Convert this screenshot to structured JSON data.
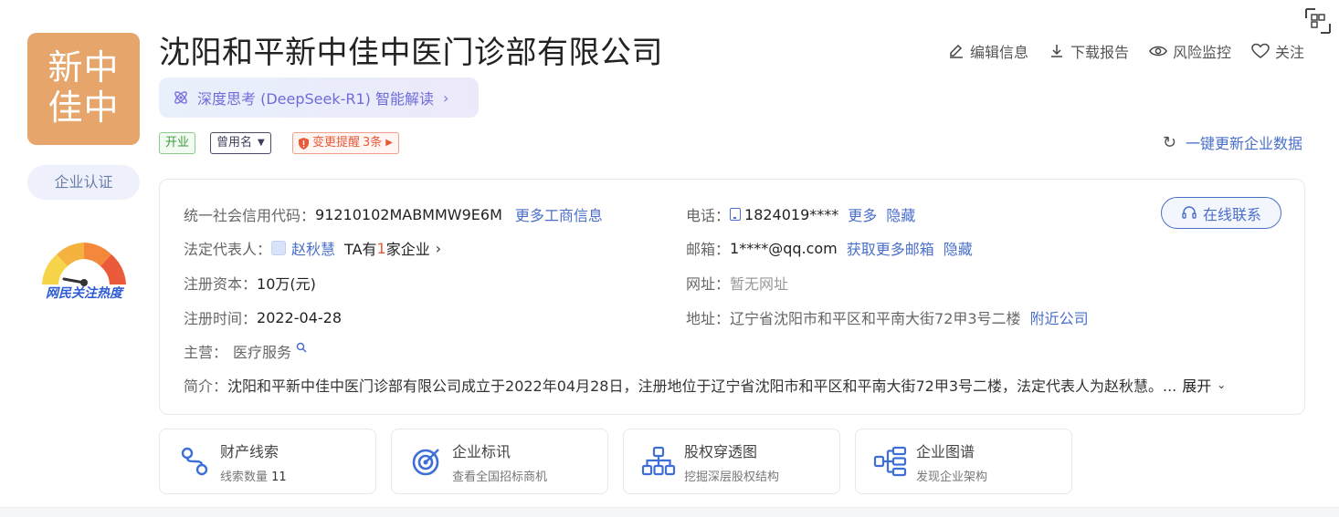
{
  "logo": {
    "line1": "新中",
    "line2": "佳中"
  },
  "cert_label": "企业认证",
  "heat_label": "网民关注热度",
  "company_name": "沈阳和平新中佳中医门诊部有限公司",
  "ai": {
    "label": "深度思考 (DeepSeek-R1) 智能解读",
    "chevron": "›"
  },
  "tags": {
    "status": "开业",
    "used_name": "曾用名",
    "change": "变更提醒",
    "change_count": "3条"
  },
  "actions": [
    {
      "icon": "edit-icon",
      "label": "编辑信息"
    },
    {
      "icon": "download-icon",
      "label": "下载报告"
    },
    {
      "icon": "eye-icon",
      "label": "风险监控"
    },
    {
      "icon": "heart-icon",
      "label": "关注"
    }
  ],
  "update_label": "一键更新企业数据",
  "info": {
    "credit_label": "统一社会信用代码：",
    "credit_value": "91210102MABMMW9E6M",
    "credit_link": "更多工商信息",
    "legal_label": "法定代表人：",
    "legal_name": "赵秋慧",
    "legal_ta": "TA有",
    "legal_count": "1",
    "legal_suffix": "家企业",
    "capital_label": "注册资本：",
    "capital_value": "10万(元)",
    "date_label": "注册时间：",
    "date_value": "2022-04-28",
    "business_label": "主营：",
    "business_value": "医疗服务",
    "intro_label": "简介：",
    "intro_value": "沈阳和平新中佳中医门诊部有限公司成立于2022年04月28日，注册地位于辽宁省沈阳市和平区和平南大街72甲3号二楼，法定代表人为赵秋慧。...",
    "intro_expand": "展开",
    "phone_label": "电话：",
    "phone_value": "1824019****",
    "phone_more": "更多",
    "phone_hide": "隐藏",
    "email_label": "邮箱：",
    "email_value": "1****@qq.com",
    "email_more": "获取更多邮箱",
    "email_hide": "隐藏",
    "site_label": "网址：",
    "site_value": "暂无网址",
    "addr_label": "地址：",
    "addr_value": "辽宁省沈阳市和平区和平南大街72甲3号二楼",
    "addr_link": "附近公司",
    "contact_btn": "在线联系"
  },
  "cards": [
    {
      "title": "财产线索",
      "sub_prefix": "线索数量 ",
      "sub_count": "11"
    },
    {
      "title": "企业标讯",
      "sub": "查看全国招标商机"
    },
    {
      "title": "股权穿透图",
      "sub": "挖掘深层股权结构"
    },
    {
      "title": "企业图谱",
      "sub": "发现企业架构"
    }
  ]
}
